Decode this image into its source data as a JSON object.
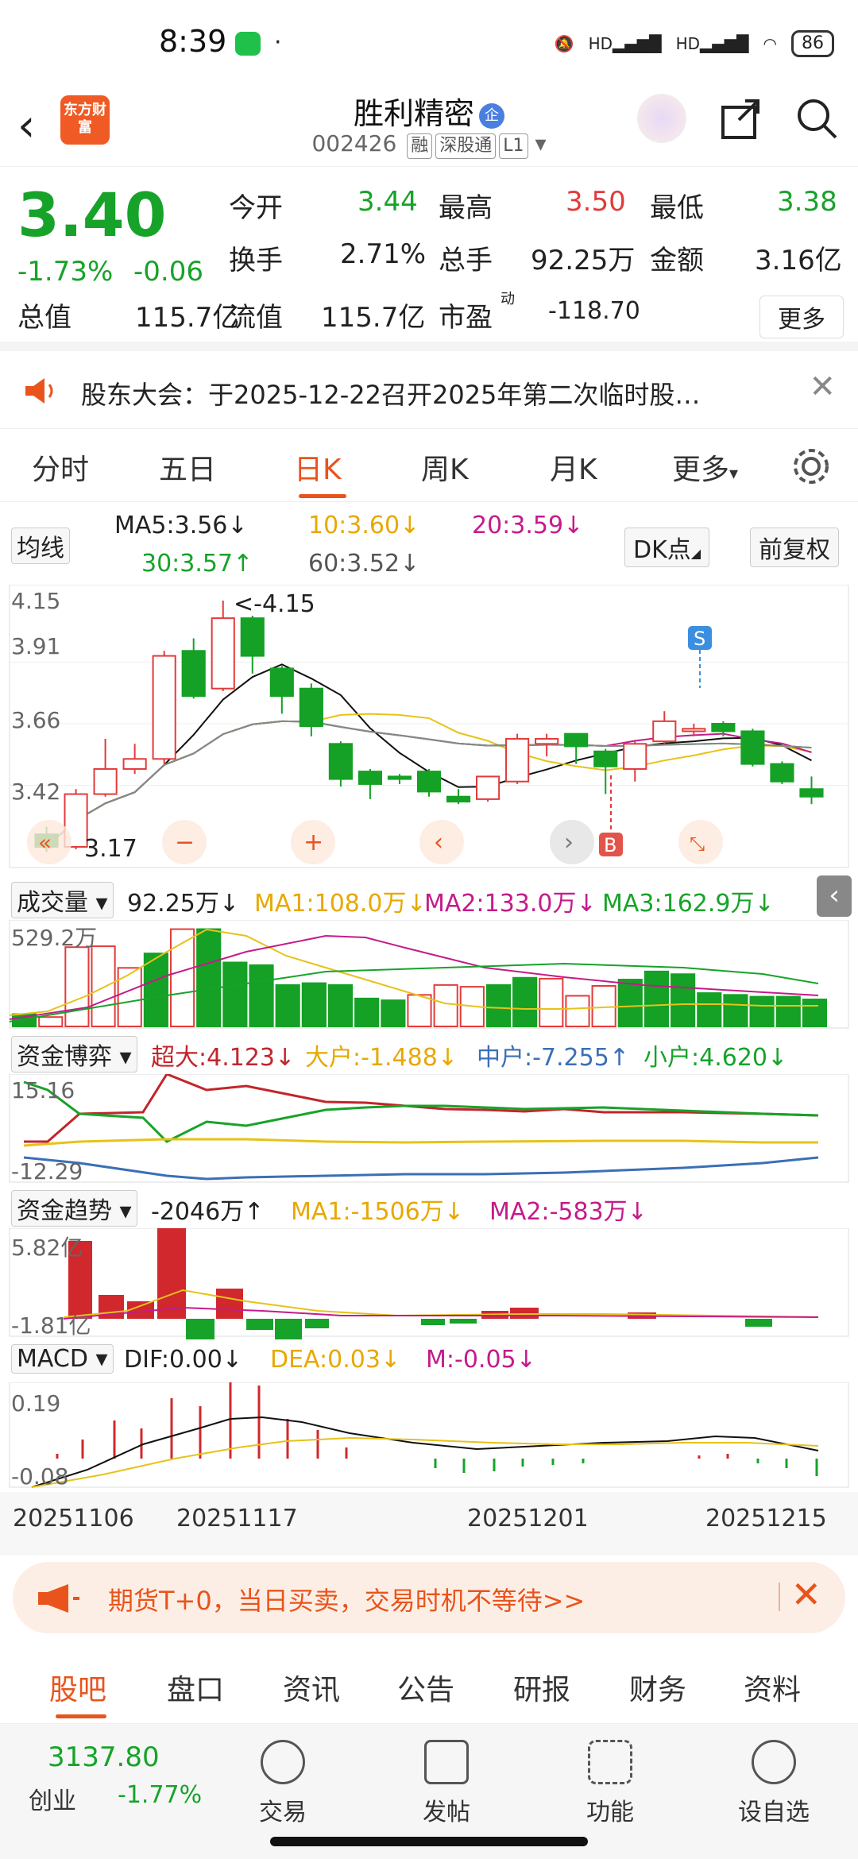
{
  "status": {
    "time": "8:39",
    "battery": "86"
  },
  "header": {
    "logo_text": "东方财富",
    "name": "胜利精密",
    "qi_badge": "企",
    "code": "002426",
    "tags": [
      "融",
      "深股通",
      "L1"
    ]
  },
  "quote": {
    "price": "3.40",
    "pct": "-1.73%",
    "chg": "-0.06",
    "open_label": "今开",
    "open": "3.44",
    "high_label": "最高",
    "high": "3.50",
    "low_label": "最低",
    "low": "3.38",
    "turnover_label": "换手",
    "turnover": "2.71%",
    "volume_label": "总手",
    "volume": "92.25万",
    "amount_label": "金额",
    "amount": "3.16亿",
    "mktcap_label": "总值",
    "mktcap": "115.7亿",
    "float_label": "流值",
    "float": "115.7亿",
    "pe_label": "市盈",
    "pe_sup": "动",
    "pe": "-118.70",
    "more": "更多"
  },
  "notice": {
    "text": "股东大会：于2025-12-22召开2025年第二次临时股…"
  },
  "tabs": [
    "分时",
    "五日",
    "日K",
    "周K",
    "月K",
    "更多"
  ],
  "ma_line": {
    "selector": "均线",
    "ma5": "MA5:3.56↓",
    "ma10": "10:3.60↓",
    "ma20": "20:3.59↓",
    "ma30": "30:3.57↑",
    "ma60": "60:3.52↓",
    "dk": "DK点",
    "fq": "前复权"
  },
  "kline_axis": {
    "y1": "4.15",
    "y2": "3.91",
    "y3": "3.66",
    "y4": "3.42",
    "low_mark": "3.17",
    "high_mark": "<-4.15",
    "s_mark": "S",
    "b_mark": "B"
  },
  "volume_line": {
    "selector": "成交量",
    "val": "92.25万↓",
    "ma1": "MA1:108.0万↓",
    "ma2": "MA2:133.0万↓",
    "ma3": "MA3:162.9万↓",
    "axis": "529.2万"
  },
  "fund_line": {
    "selector": "资金博弈",
    "super": "超大:4.123↓",
    "big": "大户:-1.488↓",
    "mid": "中户:-7.255↑",
    "small": "小户:4.620↓",
    "axis_top": "15.16",
    "axis_bottom": "-12.29"
  },
  "trend_line": {
    "selector": "资金趋势",
    "val": "-2046万↑",
    "ma1": "MA1:-1506万↓",
    "ma2": "MA2:-583万↓",
    "axis_top": "5.82亿",
    "axis_bottom": "-1.81亿"
  },
  "macd_line": {
    "selector": "MACD",
    "dif": "DIF:0.00↓",
    "dea": "DEA:0.03↓",
    "m": "M:-0.05↓",
    "axis_top": "0.19",
    "axis_bottom": "-0.08"
  },
  "dates": [
    "20251106",
    "20251117",
    "20251201",
    "20251215"
  ],
  "banner": {
    "text": "期货T+0，当日买卖，交易时机不等待>>"
  },
  "bottom_tabs": [
    "股吧",
    "盘口",
    "资讯",
    "公告",
    "研报",
    "财务",
    "资料"
  ],
  "nav": {
    "index_value": "3137.80",
    "index_name": "创业",
    "index_pct": "-1.77%",
    "items": [
      "交易",
      "发帖",
      "功能",
      "设自选"
    ]
  },
  "chart_data": {
    "type": "candlestick",
    "ylim": [
      3.17,
      4.15
    ],
    "candles": [
      {
        "o": 3.22,
        "c": 3.17,
        "h": 3.25,
        "l": 3.15
      },
      {
        "o": 3.17,
        "c": 3.38,
        "h": 3.4,
        "l": 3.16
      },
      {
        "o": 3.38,
        "c": 3.48,
        "h": 3.6,
        "l": 3.37
      },
      {
        "o": 3.48,
        "c": 3.52,
        "h": 3.58,
        "l": 3.46
      },
      {
        "o": 3.52,
        "c": 3.93,
        "h": 3.95,
        "l": 3.5
      },
      {
        "o": 3.95,
        "c": 3.77,
        "h": 4.0,
        "l": 3.76
      },
      {
        "o": 3.8,
        "c": 4.08,
        "h": 4.15,
        "l": 3.79
      },
      {
        "o": 4.08,
        "c": 3.93,
        "h": 4.09,
        "l": 3.86
      },
      {
        "o": 3.88,
        "c": 3.77,
        "h": 3.89,
        "l": 3.7
      },
      {
        "o": 3.8,
        "c": 3.65,
        "h": 3.82,
        "l": 3.61
      },
      {
        "o": 3.58,
        "c": 3.44,
        "h": 3.59,
        "l": 3.41
      },
      {
        "o": 3.47,
        "c": 3.42,
        "h": 3.48,
        "l": 3.36
      },
      {
        "o": 3.45,
        "c": 3.44,
        "h": 3.46,
        "l": 3.42
      },
      {
        "o": 3.47,
        "c": 3.39,
        "h": 3.48,
        "l": 3.37
      },
      {
        "o": 3.37,
        "c": 3.35,
        "h": 3.4,
        "l": 3.34
      },
      {
        "o": 3.36,
        "c": 3.45,
        "h": 3.45,
        "l": 3.35
      },
      {
        "o": 3.43,
        "c": 3.6,
        "h": 3.62,
        "l": 3.42
      },
      {
        "o": 3.58,
        "c": 3.6,
        "h": 3.62,
        "l": 3.53
      },
      {
        "o": 3.62,
        "c": 3.57,
        "h": 3.62,
        "l": 3.5
      },
      {
        "o": 3.55,
        "c": 3.49,
        "h": 3.56,
        "l": 3.38
      },
      {
        "o": 3.48,
        "c": 3.58,
        "h": 3.59,
        "l": 3.43
      },
      {
        "o": 3.59,
        "c": 3.67,
        "h": 3.71,
        "l": 3.58
      },
      {
        "o": 3.63,
        "c": 3.64,
        "h": 3.66,
        "l": 3.61
      },
      {
        "o": 3.66,
        "c": 3.63,
        "h": 3.67,
        "l": 3.61
      },
      {
        "o": 3.63,
        "c": 3.5,
        "h": 3.64,
        "l": 3.49
      },
      {
        "o": 3.5,
        "c": 3.43,
        "h": 3.51,
        "l": 3.42
      },
      {
        "o": 3.4,
        "c": 3.37,
        "h": 3.45,
        "l": 3.34
      }
    ],
    "volume_ylim": [
      0,
      529.2
    ],
    "volume": [
      68,
      52,
      440,
      445,
      325,
      405,
      540,
      540,
      355,
      340,
      230,
      240,
      230,
      155,
      145,
      175,
      230,
      220,
      230,
      270,
      265,
      170,
      225,
      260,
      305,
      290,
      185,
      175,
      165,
      165,
      150
    ],
    "dates": [
      "20251106",
      "20251117",
      "20251201",
      "20251215"
    ]
  }
}
